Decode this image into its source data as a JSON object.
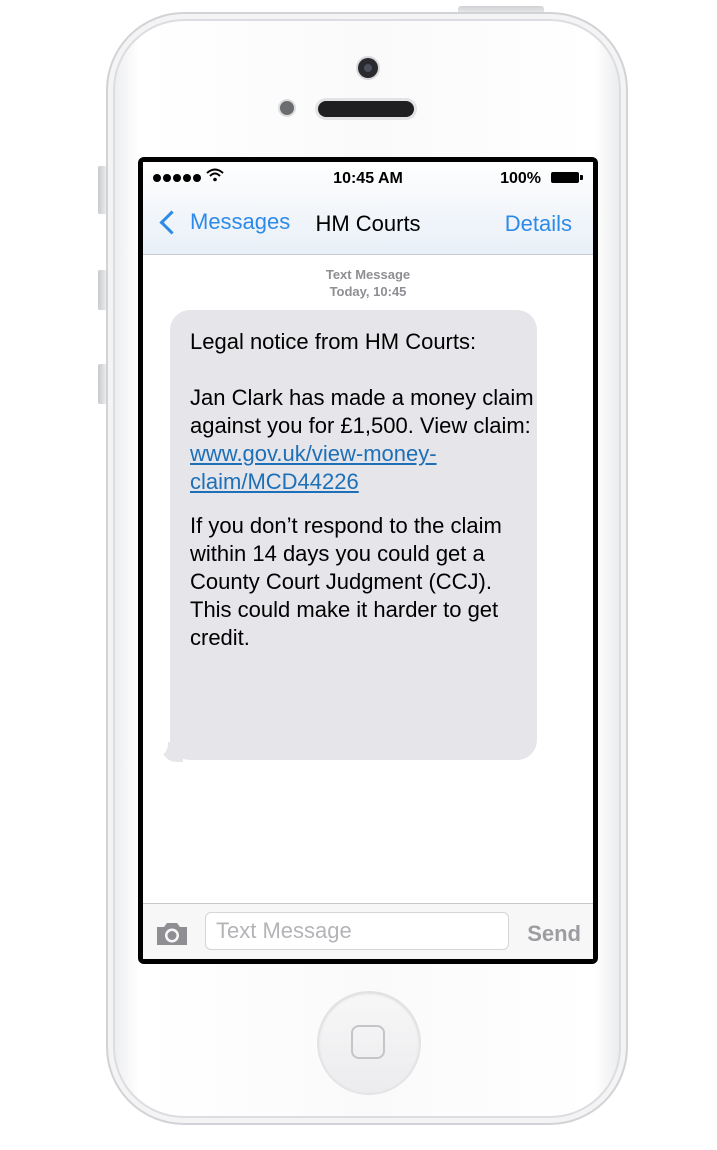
{
  "status_bar": {
    "time": "10:45 AM",
    "battery": "100%",
    "signal_icon": "signal-dots-icon",
    "wifi_icon": "wifi-icon",
    "battery_icon": "battery-icon"
  },
  "nav": {
    "back_label": "Messages",
    "title": "HM Courts",
    "details_label": "Details"
  },
  "message": {
    "type_label": "Text Message",
    "timestamp": "Today, 10:45",
    "line1": "Legal notice from HM Courts:",
    "line2": "Jan Clark has made a money claim against you for £1,500. View claim: ",
    "link_text": "www.gov.uk/view-money-claim/MCD44226",
    "line3": "If you don’t respond to the claim within 14 days you could get a County Court Judgment (CCJ). This could make it harder to get credit."
  },
  "composer": {
    "placeholder": "Text Message",
    "send_label": "Send",
    "camera_icon": "camera-icon"
  },
  "colors": {
    "accent": "#2c8ae8",
    "bubble": "#e5e5ea",
    "link": "#1d70b8"
  }
}
